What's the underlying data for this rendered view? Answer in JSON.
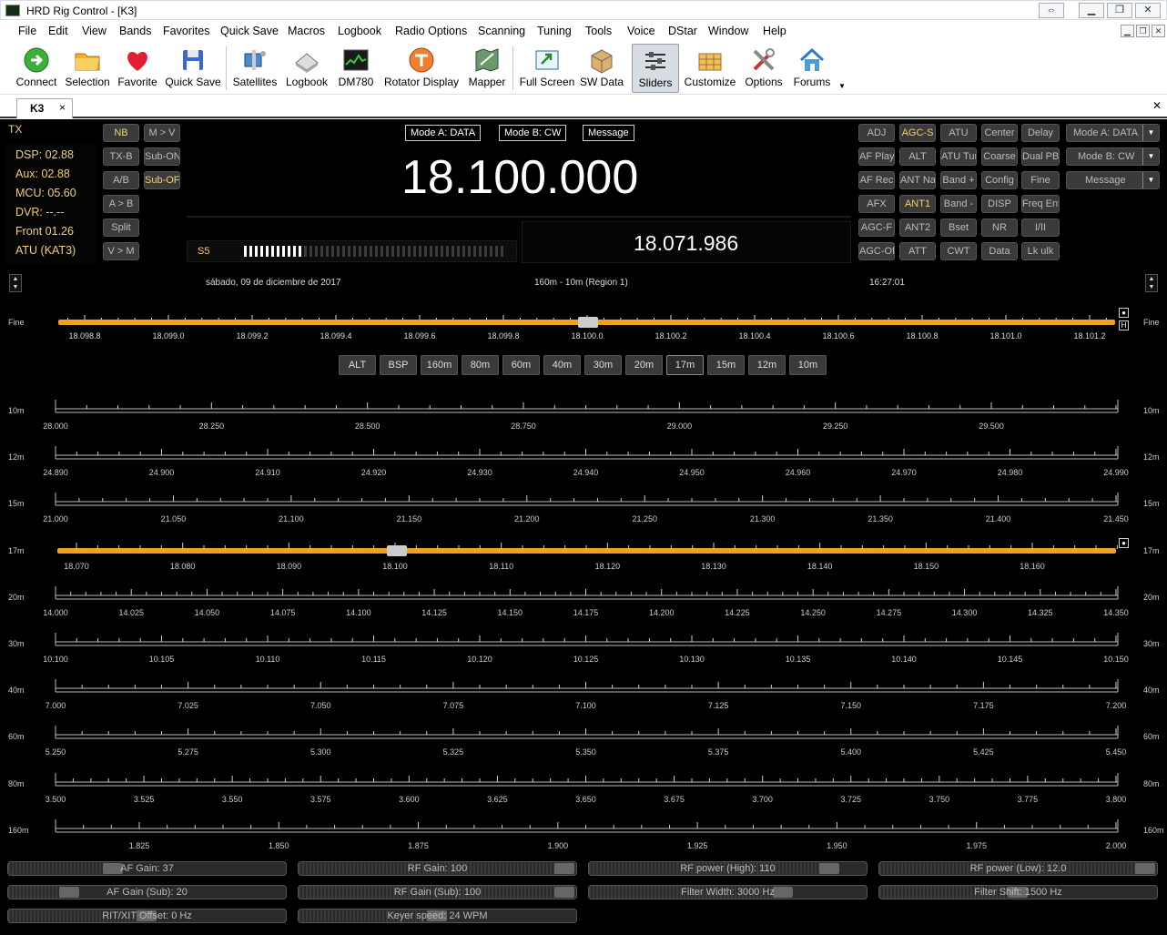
{
  "window": {
    "title": "HRD Rig Control - [K3]"
  },
  "menu": [
    "File",
    "Edit",
    "View",
    "Bands",
    "Favorites",
    "Quick Save",
    "Macros",
    "Logbook",
    "Radio Options",
    "Scanning",
    "Tuning",
    "Tools",
    "Voice",
    "DStar",
    "Window",
    "Help"
  ],
  "toolbar": [
    "Connect",
    "Selection",
    "Favorite",
    "Quick Save",
    "Satellites",
    "Logbook",
    "DM780",
    "Rotator Display",
    "Mapper",
    "Full Screen",
    "SW Data",
    "Sliders",
    "Customize",
    "Options",
    "Forums"
  ],
  "tab": {
    "label": "K3",
    "close": "×"
  },
  "status": {
    "tx": "TX",
    "dsp": "DSP:  02.88",
    "aux": "Aux:  02.88",
    "mcu": "MCU:  05.60",
    "dvr": "DVR:  --.--",
    "front": "Front 01.26",
    "atu": "ATU (KAT3)"
  },
  "left_buttons": [
    "NB",
    "M > V",
    "TX-B",
    "Sub-ON",
    "A/B",
    "Sub-OFF",
    "A > B",
    "Split",
    "V > M"
  ],
  "modes": {
    "a": "Mode A: DATA",
    "b": "Mode B: CW",
    "msg": "Message"
  },
  "frequency": {
    "main": "18.100.000",
    "sub": "18.071.986"
  },
  "smeter": {
    "label": "S5",
    "level": 0.22
  },
  "right_buttons": [
    "ADJ",
    "AGC-S",
    "ATU",
    "Center",
    "Delay",
    "AF Play",
    "ALT",
    "ATU Tune",
    "Coarse",
    "Dual PB",
    "AF Rec",
    "ANT Name",
    "Band +",
    "Config",
    "Fine",
    "AFX",
    "ANT1",
    "Band -",
    "DISP",
    "Freq Ent",
    "AGC-F",
    "ANT2",
    "Bset",
    "NR",
    "I/II",
    "AGC-Off",
    "ATT",
    "CWT",
    "Data",
    "Lk ulk"
  ],
  "dropdowns": [
    "Mode A: DATA",
    "Mode B: CW",
    "Message"
  ],
  "info": {
    "date": "sábado, 09 de diciembre de 2017",
    "region": "160m - 10m (Region 1)",
    "time": "16:27:01"
  },
  "fine": {
    "label": "Fine",
    "ticks": [
      "18.098.8",
      "18.099.0",
      "18.099.2",
      "18.099.4",
      "18.099.6",
      "18.099.8",
      "18.100.0",
      "18.100.2",
      "18.100.4",
      "18.100.6",
      "18.100.8",
      "18.101.0",
      "18.101.2"
    ],
    "h": "H"
  },
  "band_buttons": [
    "ALT",
    "BSP",
    "160m",
    "80m",
    "60m",
    "40m",
    "30m",
    "20m",
    "17m",
    "15m",
    "12m",
    "10m"
  ],
  "scales": [
    {
      "label": "10m",
      "ticks": [
        "28.000",
        "28.250",
        "28.500",
        "28.750",
        "29.000",
        "29.250",
        "29.500"
      ]
    },
    {
      "label": "12m",
      "ticks": [
        "24.890",
        "24.900",
        "24.910",
        "24.920",
        "24.930",
        "24.940",
        "24.950",
        "24.960",
        "24.970",
        "24.980",
        "24.990"
      ]
    },
    {
      "label": "15m",
      "ticks": [
        "21.000",
        "21.050",
        "21.100",
        "21.150",
        "21.200",
        "21.250",
        "21.300",
        "21.350",
        "21.400",
        "21.450"
      ]
    },
    {
      "label": "17m",
      "ticks": [
        "18.070",
        "18.080",
        "18.090",
        "18.100",
        "18.110",
        "18.120",
        "18.130",
        "18.140",
        "18.150",
        "18.160"
      ]
    },
    {
      "label": "20m",
      "ticks": [
        "14.000",
        "14.025",
        "14.050",
        "14.075",
        "14.100",
        "14.125",
        "14.150",
        "14.175",
        "14.200",
        "14.225",
        "14.250",
        "14.275",
        "14.300",
        "14.325",
        "14.350"
      ]
    },
    {
      "label": "30m",
      "ticks": [
        "10.100",
        "10.105",
        "10.110",
        "10.115",
        "10.120",
        "10.125",
        "10.130",
        "10.135",
        "10.140",
        "10.145",
        "10.150"
      ]
    },
    {
      "label": "40m",
      "ticks": [
        "7.000",
        "7.025",
        "7.050",
        "7.075",
        "7.100",
        "7.125",
        "7.150",
        "7.175",
        "7.200"
      ]
    },
    {
      "label": "60m",
      "ticks": [
        "5.250",
        "5.275",
        "5.300",
        "5.325",
        "5.350",
        "5.375",
        "5.400",
        "5.425",
        "5.450"
      ]
    },
    {
      "label": "80m",
      "ticks": [
        "3.500",
        "3.525",
        "3.550",
        "3.575",
        "3.600",
        "3.625",
        "3.650",
        "3.675",
        "3.700",
        "3.725",
        "3.750",
        "3.775",
        "3.800"
      ]
    },
    {
      "label": "160m",
      "ticks": [
        "1.825",
        "1.850",
        "1.875",
        "1.900",
        "1.925",
        "1.950",
        "1.975",
        "2.000"
      ]
    }
  ],
  "sliders": [
    {
      "label": "AF Gain: 37",
      "value": 0.37
    },
    {
      "label": "RF Gain: 100",
      "value": 1.0
    },
    {
      "label": "RF power (High): 110",
      "value": 0.9
    },
    {
      "label": "RF power (Low): 12.0",
      "value": 1.0
    },
    {
      "label": "AF Gain (Sub): 20",
      "value": 0.2
    },
    {
      "label": "RF Gain (Sub): 100",
      "value": 1.0
    },
    {
      "label": "Filter Width: 3000 Hz",
      "value": 0.72
    },
    {
      "label": "Filter Shift: 1500 Hz",
      "value": 0.5
    },
    {
      "label": "RIT/XIT Offset: 0 Hz",
      "value": 0.5
    },
    {
      "label": "Keyer speed: 24 WPM",
      "value": 0.5
    }
  ],
  "colors": {
    "accent": "#f0a020",
    "text_active": "#f0d070",
    "bg": "#000000"
  }
}
